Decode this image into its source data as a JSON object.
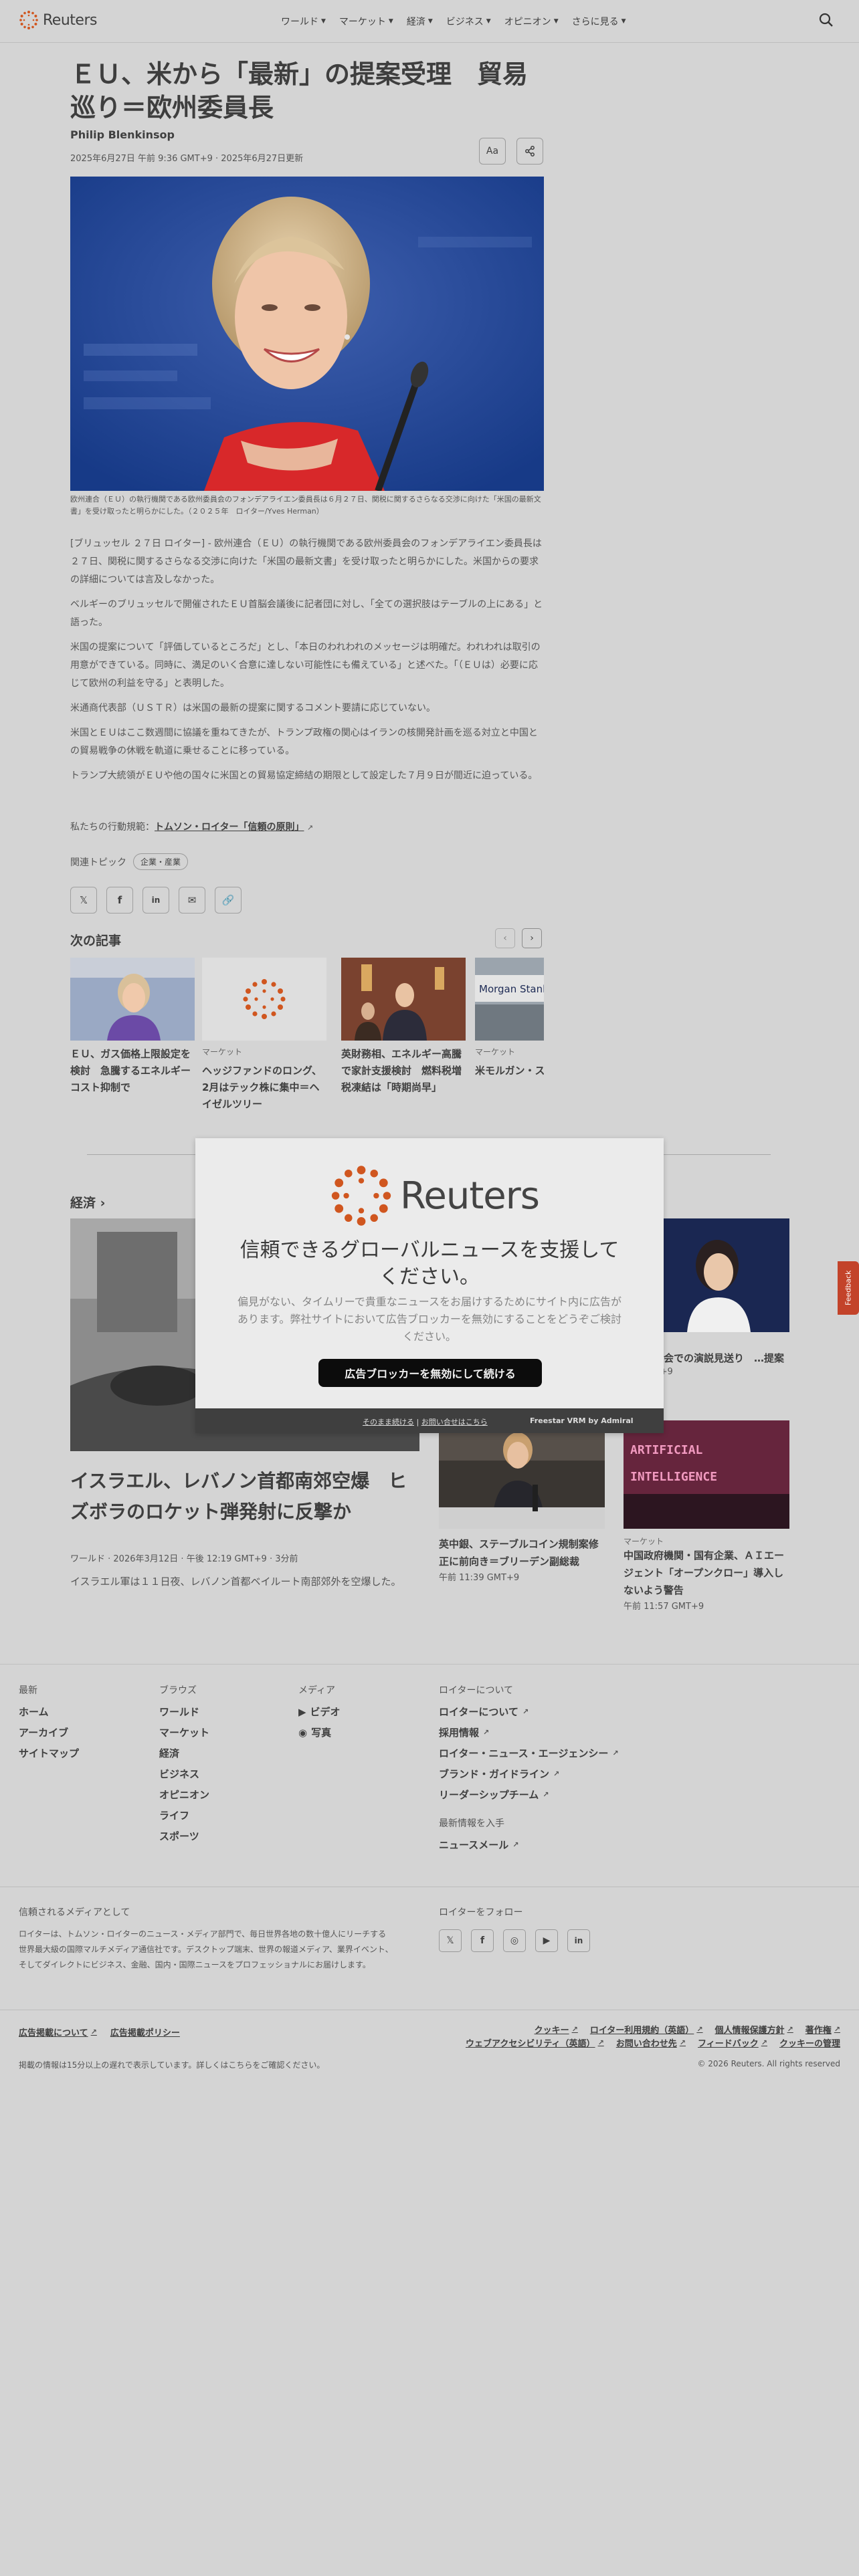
{
  "brand": {
    "name": "Reuters",
    "accent": "#d0561f"
  },
  "nav": {
    "items": [
      {
        "label": "ワールド"
      },
      {
        "label": "マーケット"
      },
      {
        "label": "経済"
      },
      {
        "label": "ビジネス"
      },
      {
        "label": "オピニオン"
      },
      {
        "label": "さらに見る"
      }
    ]
  },
  "article": {
    "title": "ＥＵ、米から「最新」の提案受理　貿易巡り＝欧州委員長",
    "author": "Philip Blenkinsop",
    "date": "2025年6月27日 午前 9:36 GMT+9 · 2025年6月27日更新",
    "text_size_label": "Aa",
    "caption": "欧州連合（ＥＵ）の執行機関である欧州委員会のフォンデアライエン委員長は６月２７日、関税に関するさらなる交渉に向けた「米国の最新文書」を受け取ったと明らかにした。（２０２５年　ロイター/Yves Herman）",
    "paragraphs": [
      "[ブリュッセル ２７日 ロイター] - 欧州連合（ＥＵ）の執行機関である欧州委員会のフォンデアライエン委員長は２７日、関税に関するさらなる交渉に向けた「米国の最新文書」を受け取ったと明らかにした。米国からの要求の詳細については言及しなかった。",
      "ベルギーのブリュッセルで開催されたＥＵ首脳会議後に記者団に対し、「全ての選択肢はテーブルの上にある」と語った。",
      "米国の提案について「評価しているところだ」とし、「本日のわれわれのメッセージは明確だ。われわれは取引の用意ができている。同時に、満足のいく合意に達しない可能性にも備えている」と述べた。「（ＥＵは）必要に応じて欧州の利益を守る」と表明した。",
      "米通商代表部（ＵＳＴＲ）は米国の最新の提案に関するコメント要請に応じていない。",
      "米国とＥＵはここ数週間に協議を重ねてきたが、トランプ政権の関心はイランの核開発計画を巡る対立と中国との貿易戦争の休戦を軌道に乗せることに移っている。",
      "トランプ大統領がＥＵや他の国々に米国との貿易協定締結の期限として設定した７月９日が間近に迫っている。"
    ],
    "conduct_prefix": "私たちの行動規範：",
    "conduct_link": "トムソン・ロイター「信頼の原則」",
    "topics_label": "関連トピック",
    "topic_tag": "企業・産業"
  },
  "next_articles": {
    "heading": "次の記事",
    "items": [
      {
        "category": "",
        "title": "ＥＵ、ガス価格上限設定を検討　急騰するエネルギーコスト抑制で"
      },
      {
        "category": "マーケット",
        "title": "ヘッジファンドのロング、2月はテック株に集中＝ヘイゼルツリー"
      },
      {
        "category": "",
        "title": "英財務相、エネルギー高騰で家計支援検討　燃料税増税凍結は「時期尚早」"
      },
      {
        "category": "マーケット",
        "title": "米モルガン・スタンレーの融資ファンド、解約請求を制限　償還額"
      }
    ]
  },
  "economy": {
    "heading": "経済",
    "big": {
      "title": "イスラエル、レバノン首都南郊空爆　ヒズボラのロケット弾発射に反撃か",
      "meta": "ワールド · 2026年3月12日 · 午後 12:19 GMT+9 · 3分前",
      "desc": "イスラエル軍は１１日夜、レバノン首都ベイルート南部郊外を空爆した。"
    },
    "side1": {
      "title": "…、米議会での演説見送り　…提案",
      "meta": "…4 GMT+9"
    },
    "side2": {
      "title": "英中銀、ステーブルコイン規制案修正に前向き＝ブリーデン副総裁",
      "meta": "午前 11:39 GMT+9"
    },
    "side3": {
      "category": "マーケット",
      "title": "中国政府機関・国有企業、ＡＩエージェント「オープンクロー」導入しないよう警告",
      "meta": "午前 11:57 GMT+9"
    }
  },
  "modal": {
    "logo": "Reuters",
    "heading": "信頼できるグローバルニュースを支援してください。",
    "body": "偏見がない、タイムリーで貴重なニュースをお届けするためにサイト内に広告があります。弊社サイトにおいて広告ブロッカーを無効にすることをどうぞご検討ください。",
    "button": "広告ブロッカーを無効にして続ける",
    "link_continue": "そのまま続ける",
    "link_contact": "お問い合せはこちら",
    "vendor": "Freestar VRM",
    "vendor_by": "by Admiral"
  },
  "feedback": "Feedback",
  "footer": {
    "col1": {
      "heading": "最新",
      "links": [
        "ホーム",
        "アーカイブ",
        "サイトマップ"
      ]
    },
    "col2": {
      "heading": "ブラウズ",
      "links": [
        "ワールド",
        "マーケット",
        "経済",
        "ビジネス",
        "オピニオン",
        "ライフ",
        "スポーツ"
      ]
    },
    "col3": {
      "heading": "メディア",
      "links": [
        "ビデオ",
        "写真"
      ]
    },
    "col4": {
      "heading": "ロイターについて",
      "links": [
        "ロイターについて",
        "採用情報",
        "ロイター・ニュース・エージェンシー",
        "ブランド・ガイドライン",
        "リーダーシップチーム"
      ]
    },
    "col5": {
      "heading": "最新情報を入手",
      "links": [
        "ニュースメール"
      ]
    },
    "trusted_heading": "信頼されるメディアとして",
    "trusted_text": "ロイターは、トムソン・ロイターのニュース・メディア部門で、毎日世界各地の数十億人にリーチする世界最大級の国際マルチメディア通信社です。デスクトップ端末、世界の報道メディア、業界イベント、そしてダイレクトにビジネス、金融、国内・国際ニュースをプロフェッショナルにお届けします。",
    "follow_heading": "ロイターをフォロー",
    "ad_links": [
      "広告掲載について",
      "広告掲載ポリシー"
    ],
    "legal_row1": [
      "クッキー",
      "ロイター利用規約（英語）",
      "個人情報保護方針",
      "著作権"
    ],
    "legal_row2": [
      "ウェブアクセシビリティ（英語）",
      "お問い合わせ先",
      "フィードバック",
      "クッキーの管理"
    ],
    "delay_note": "掲載の情報は15分以上の遅れで表示しています。詳しくはこちらをご確認ください。",
    "copyright": "© 2026 Reuters. All rights reserved"
  }
}
